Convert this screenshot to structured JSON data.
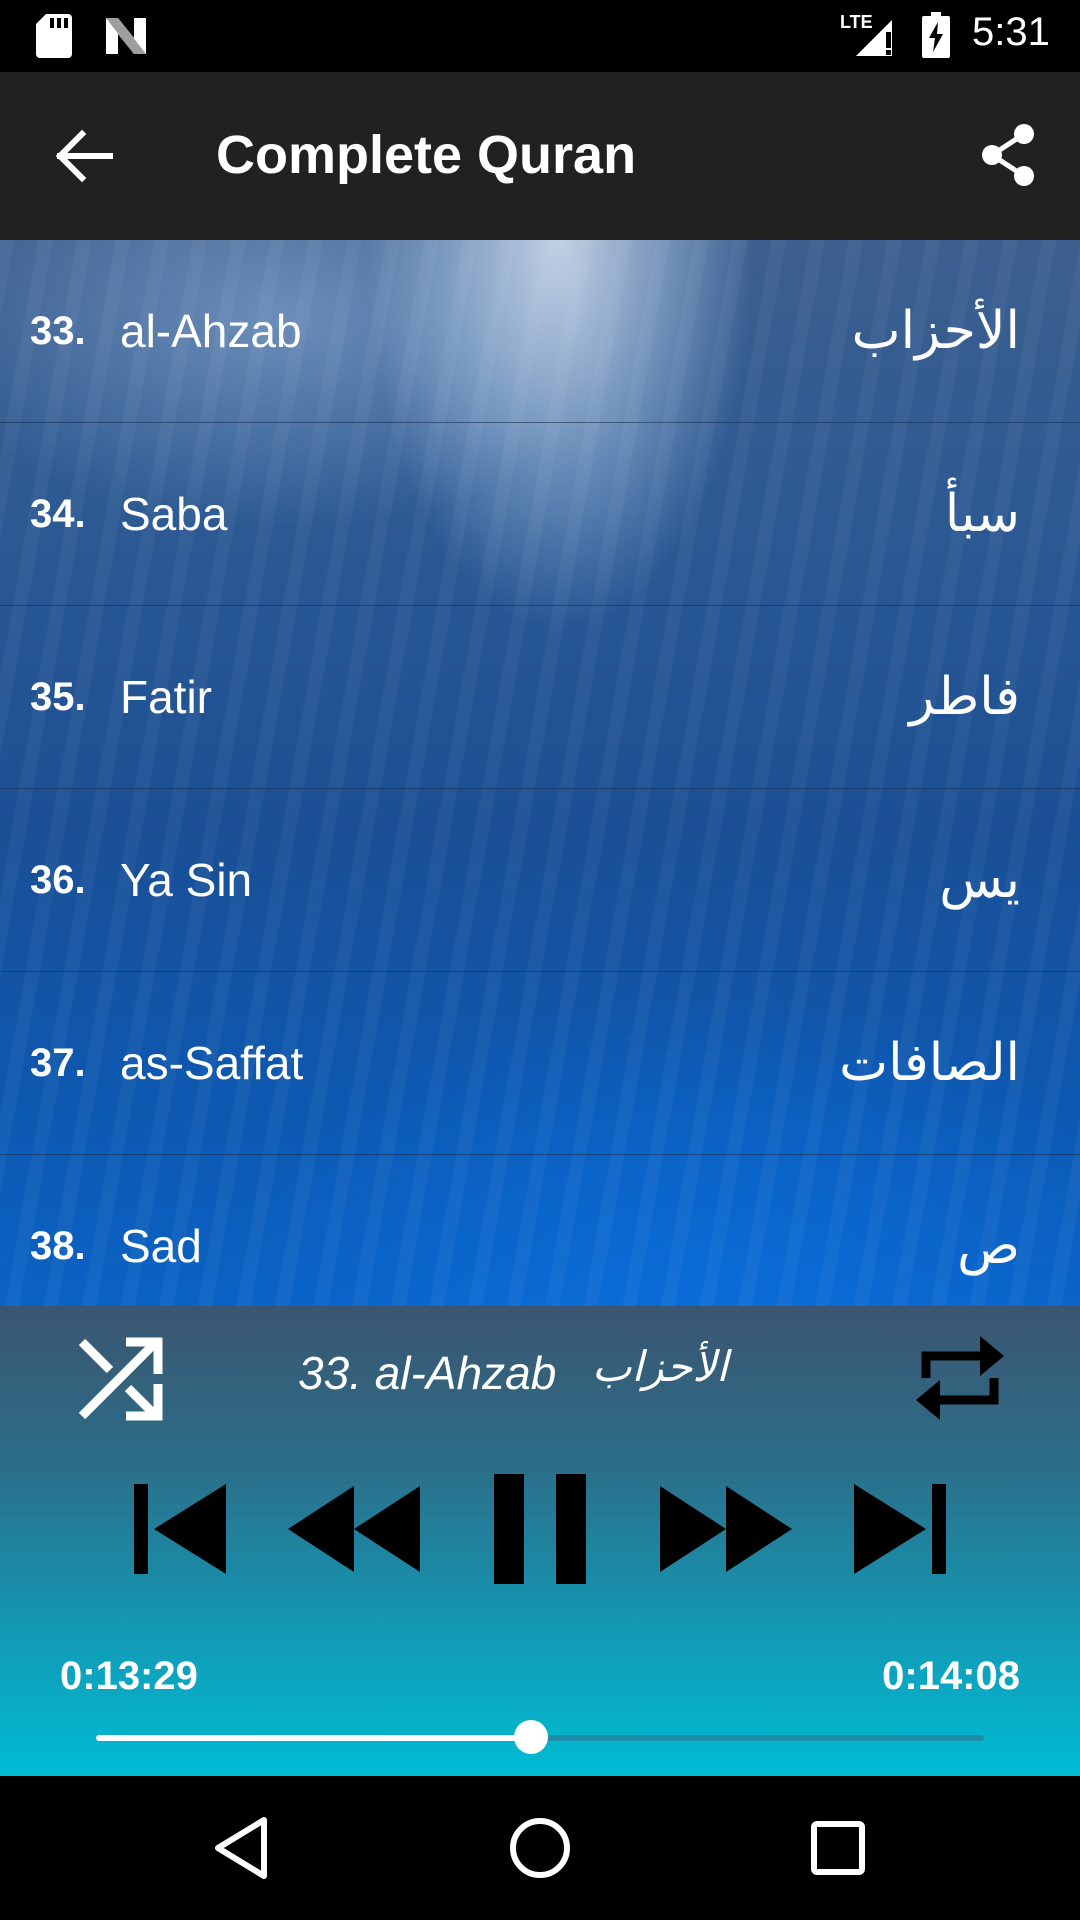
{
  "status_bar": {
    "network": "LTE",
    "time": "5:31",
    "icons": [
      "sd-card-icon",
      "n-icon",
      "signal-icon",
      "battery-charging-icon"
    ]
  },
  "app_bar": {
    "title": "Complete Quran",
    "back_icon": "arrow-back-icon",
    "share_icon": "share-icon"
  },
  "surahs": [
    {
      "number": "33.",
      "name": "al-Ahzab",
      "arabic": "الأحزاب"
    },
    {
      "number": "34.",
      "name": "Saba",
      "arabic": "سبأ"
    },
    {
      "number": "35.",
      "name": "Fatir",
      "arabic": "فاطر"
    },
    {
      "number": "36.",
      "name": "Ya Sin",
      "arabic": "يس"
    },
    {
      "number": "37.",
      "name": "as-Saffat",
      "arabic": "الصافات"
    },
    {
      "number": "38.",
      "name": "Sad",
      "arabic": "ص"
    }
  ],
  "player": {
    "now_playing": "33. al-Ahzab",
    "now_playing_arabic": "الأحزاب",
    "current_time": "0:13:29",
    "total_time": "0:14:08",
    "progress": 0.49,
    "controls": [
      "shuffle-icon",
      "skip-previous-icon",
      "rewind-icon",
      "pause-icon",
      "fast-forward-icon",
      "skip-next-icon",
      "repeat-icon"
    ]
  },
  "nav_bar": {
    "icons": [
      "nav-back-icon",
      "nav-home-icon",
      "nav-recents-icon"
    ]
  }
}
